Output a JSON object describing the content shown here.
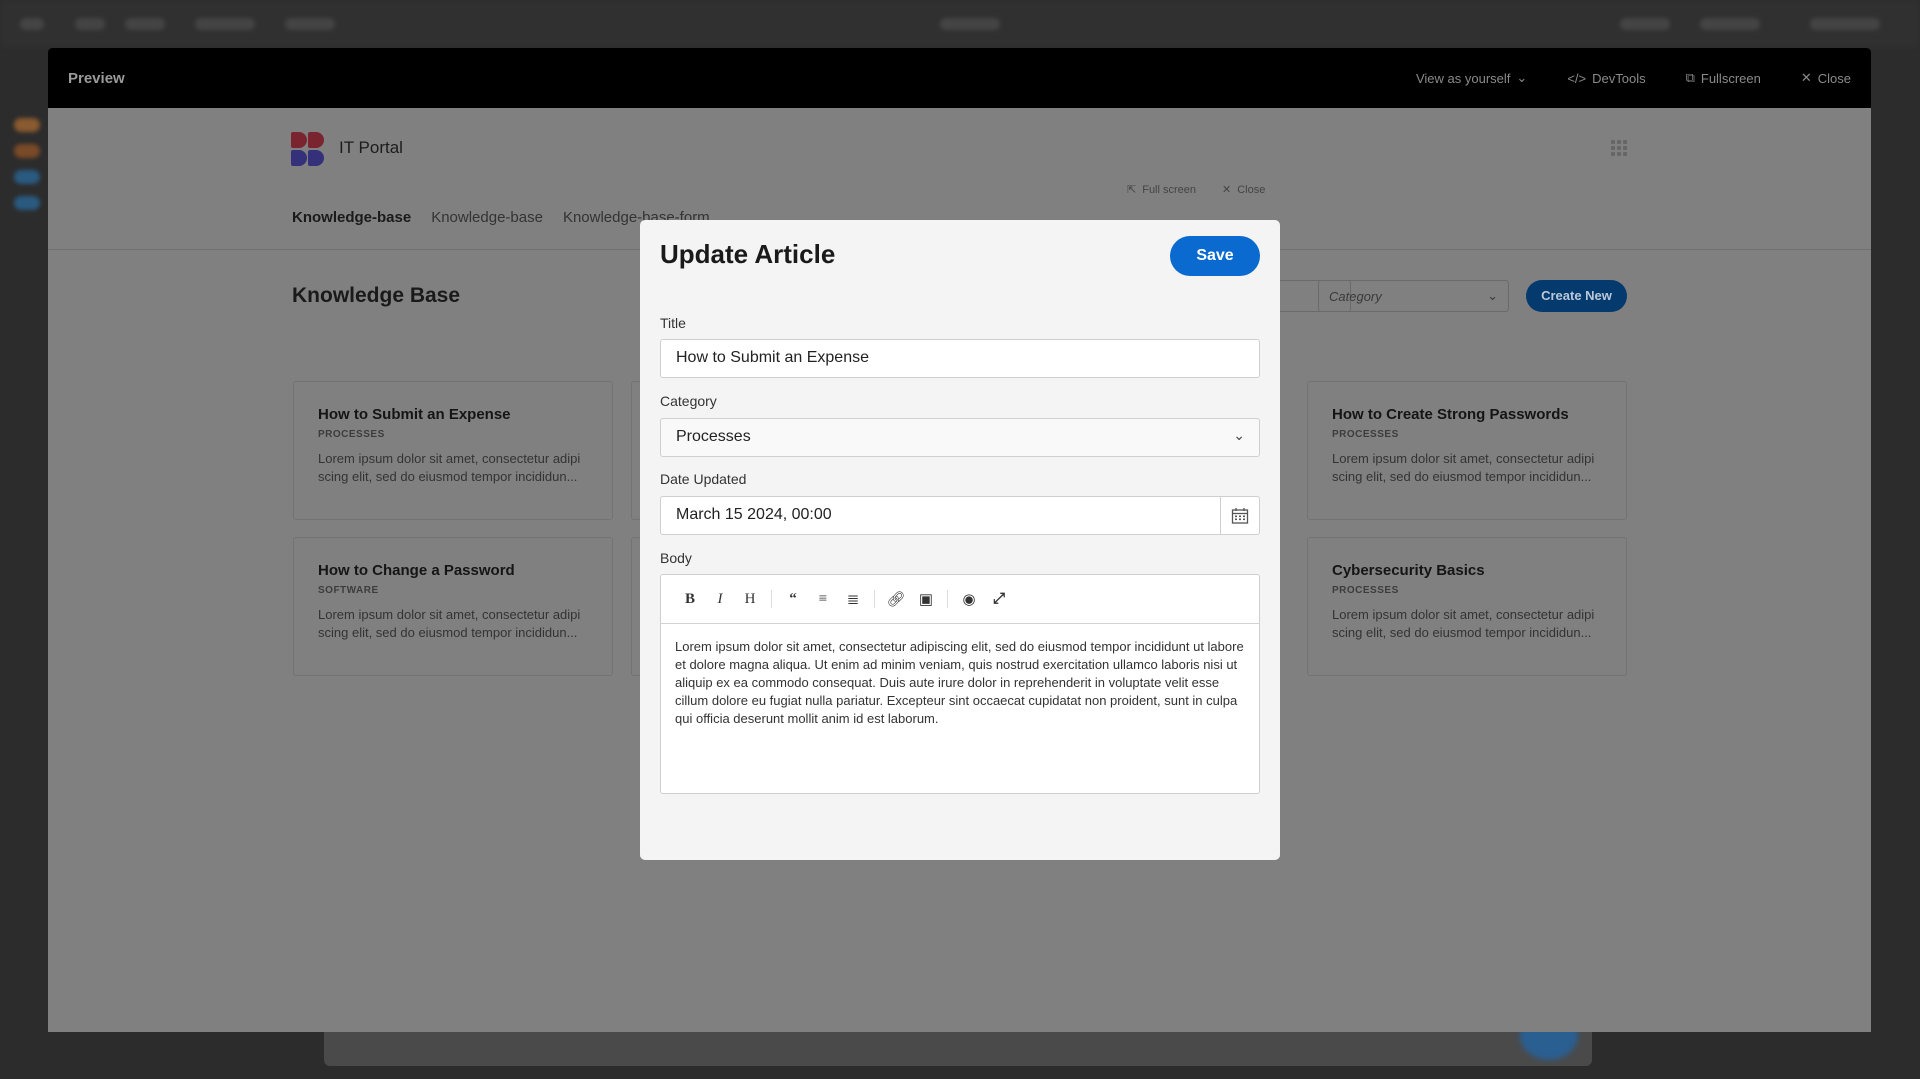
{
  "window": {
    "title": "Preview",
    "view_as": "View as yourself",
    "devtools": "DevTools",
    "fullscreen": "Fullscreen",
    "close": "Close"
  },
  "app": {
    "brand": "IT Portal",
    "full_screen": "Full screen",
    "close": "Close",
    "nav": [
      "Knowledge-base",
      "Knowledge-base",
      "Knowledge-base-form"
    ],
    "page_title": "Knowledge Base",
    "category_placeholder": "Category",
    "create_new": "Create New",
    "cards": [
      {
        "title": "How to Submit an Expense",
        "category": "PROCESSES",
        "excerpt": "Lorem ipsum dolor sit amet, consectetur adipi scing elit, sed do eiusmod tempor incididun..."
      },
      {
        "title": "How to Create Strong Passwords",
        "category": "PROCESSES",
        "excerpt": "Lorem ipsum dolor sit amet, consectetur adipi scing elit, sed do eiusmod tempor incididun..."
      },
      {
        "title": "How to Change a Password",
        "category": "SOFTWARE",
        "excerpt": "Lorem ipsum dolor sit amet, consectetur adipi scing elit, sed do eiusmod tempor incididun..."
      },
      {
        "title": "Cybersecurity Basics",
        "category": "PROCESSES",
        "excerpt": "Lorem ipsum dolor sit amet, consectetur adipi scing elit, sed do eiusmod tempor incididun..."
      }
    ]
  },
  "modal": {
    "title": "Update Article",
    "save": "Save",
    "title_label": "Title",
    "title_value": "How to Submit an Expense",
    "category_label": "Category",
    "category_value": "Processes",
    "date_label": "Date Updated",
    "date_value": "March 15 2024, 00:00",
    "body_label": "Body",
    "toolbar": [
      "bold",
      "italic",
      "heading",
      "quote",
      "unordered-list",
      "ordered-list",
      "link",
      "image",
      "preview",
      "fullscreen"
    ],
    "body": "Lorem ipsum dolor sit amet, consectetur adipiscing elit, sed do eiusmod tempor incididunt ut labore et dolore magna aliqua. Ut enim ad minim veniam, quis nostrud exercitation ullamco laboris nisi ut aliquip ex ea commodo consequat. Duis aute irure dolor in reprehenderit in voluptate velit esse cillum dolore eu fugiat nulla pariatur. Excepteur sint occaecat cupidatat non proident, sunt in culpa qui officia deserunt mollit anim id est laborum.",
    "primary_color": "#0a6ad0"
  }
}
